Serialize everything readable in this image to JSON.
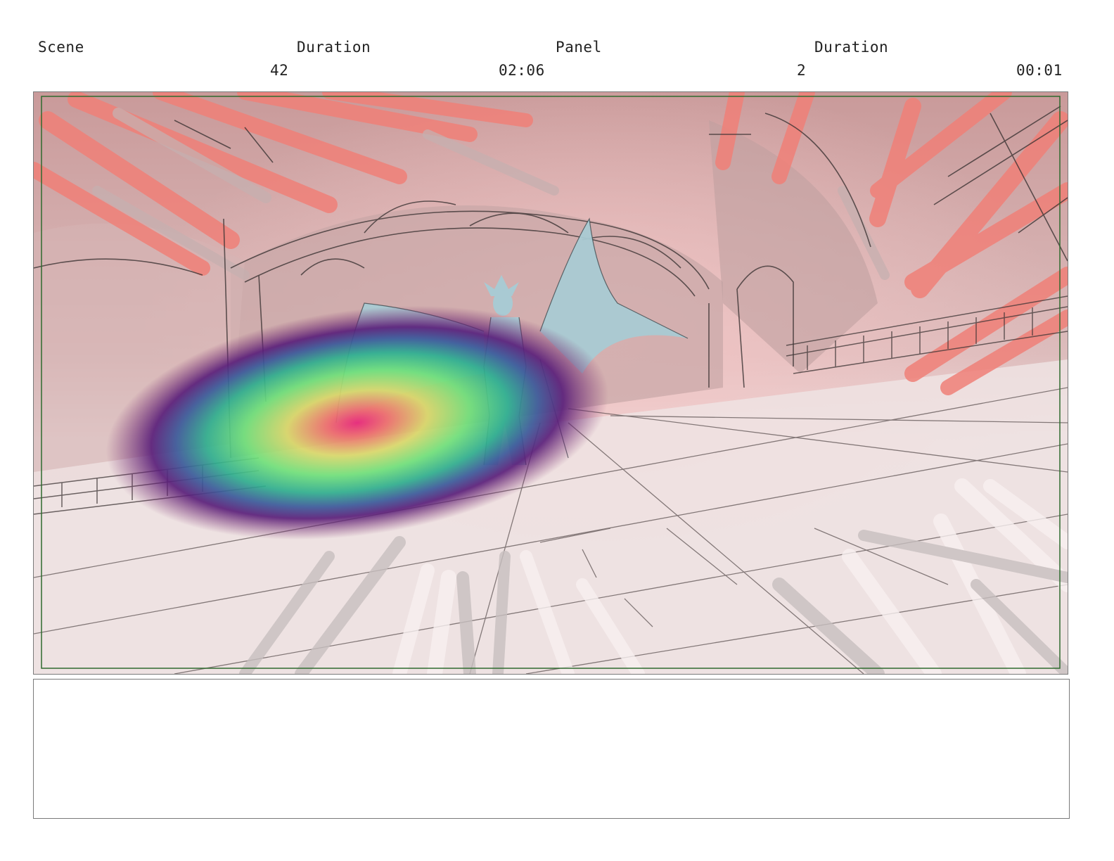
{
  "header": {
    "scene_label": "Scene",
    "duration_label_1": "Duration",
    "panel_label": "Panel",
    "duration_label_2": "Duration",
    "scene_number": "42",
    "scene_duration": "02:06",
    "panel_number": "2",
    "panel_duration": "00:01"
  },
  "panel_image": {
    "icon": "storyboard-sketch-demon-winged-figure",
    "overlay": "attention-heatmap",
    "colors": {
      "sky_red": "#f08a80",
      "stone": "#c9a9a9",
      "floor": "#ece1e1",
      "figure": "#a9cad3",
      "safe_area_border": "#2e6b2e"
    }
  },
  "notes": {
    "text": ""
  }
}
